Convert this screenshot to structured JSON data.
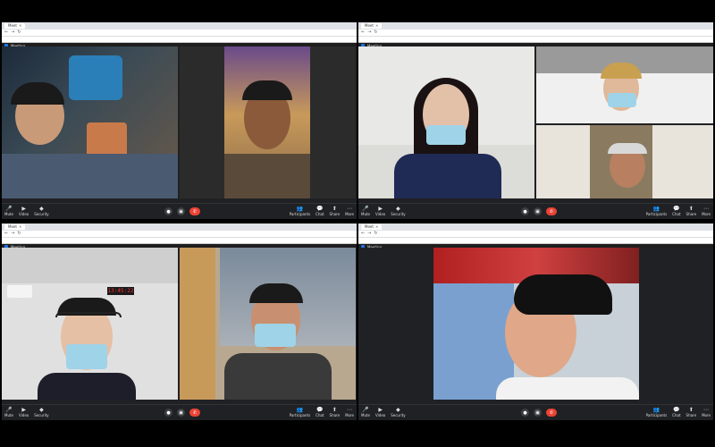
{
  "quadrants": [
    {
      "tab": "Meet",
      "meet_title": "Meeting",
      "tiles": [
        {
          "name": ""
        },
        {
          "name": ""
        }
      ]
    },
    {
      "tab": "Meet",
      "meet_title": "Meeting",
      "tiles": [
        {
          "name": ""
        },
        {
          "name": ""
        },
        {
          "name": ""
        }
      ]
    },
    {
      "tab": "Meet",
      "meet_title": "Meeting",
      "tiles": [
        {
          "name": ""
        },
        {
          "name": ""
        }
      ]
    },
    {
      "tab": "Meet",
      "meet_title": "Meeting",
      "tiles": [
        {
          "name": ""
        }
      ]
    }
  ],
  "controls": {
    "left": [
      "Mute",
      "Video",
      "Security"
    ],
    "right": [
      "Participants",
      "Chat",
      "Share",
      "More"
    ],
    "clock": "13:45:22"
  },
  "colors": {
    "end_call": "#ea4335",
    "accent": "#1a73e8",
    "mask": "#9fd3e8",
    "background": "#202124"
  }
}
